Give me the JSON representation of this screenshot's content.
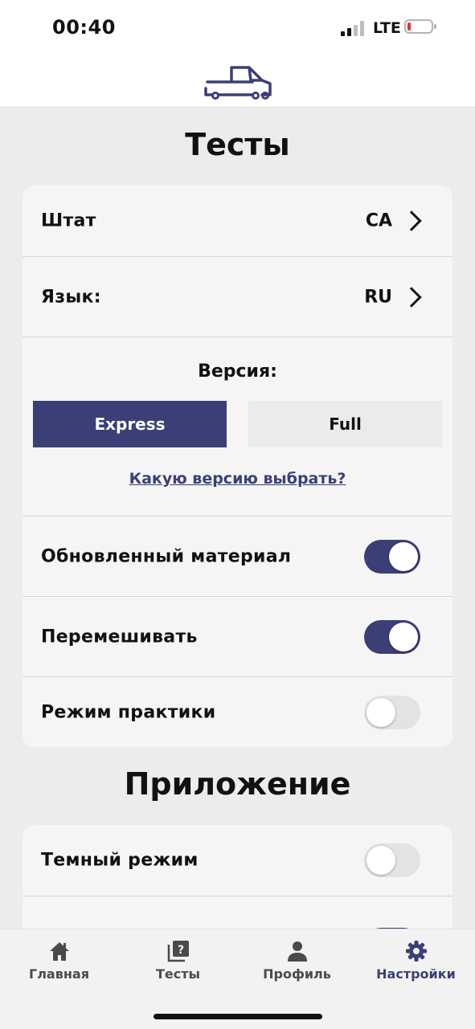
{
  "status_bar": {
    "time": "00:40",
    "network": "LTE",
    "battery_color": "#e5322d"
  },
  "header": {
    "logo_icon": "truck-icon"
  },
  "tests_section": {
    "title": "Тесты",
    "state": {
      "label": "Штат",
      "value": "CA"
    },
    "language": {
      "label": "Язык:",
      "value": "RU"
    },
    "version": {
      "title": "Версия:",
      "options": [
        "Express",
        "Full"
      ],
      "selected": "Express",
      "help_link": "Какую версию выбрать?"
    },
    "toggles": [
      {
        "label": "Обновленный материал",
        "on": true
      },
      {
        "label": "Перемешивать",
        "on": true
      },
      {
        "label": "Режим практики",
        "on": false
      }
    ]
  },
  "app_section": {
    "title": "Приложение",
    "toggles": [
      {
        "label": "Темный режим",
        "on": false
      }
    ]
  },
  "tab_bar": {
    "tabs": [
      {
        "label": "Главная",
        "icon": "home-icon"
      },
      {
        "label": "Тесты",
        "icon": "quiz-icon"
      },
      {
        "label": "Профиль",
        "icon": "person-icon"
      },
      {
        "label": "Настройки",
        "icon": "gear-icon"
      }
    ],
    "active": "Настройки"
  },
  "colors": {
    "accent": "#3c3f76",
    "background": "#ececec",
    "card": "#f5f5f5"
  }
}
